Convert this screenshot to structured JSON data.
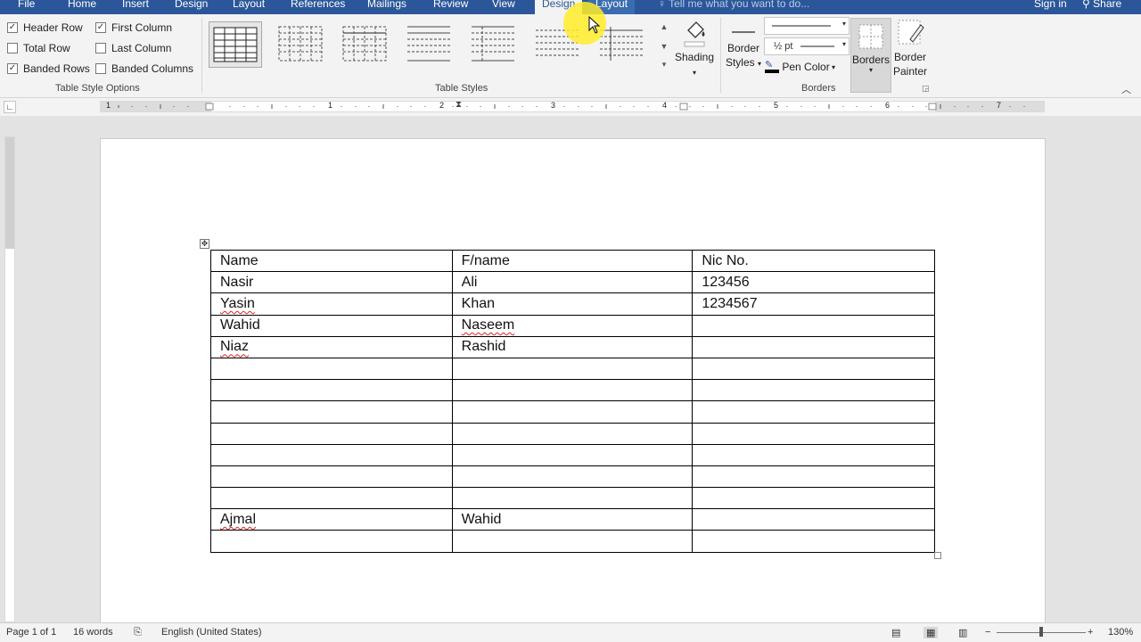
{
  "tabs": {
    "file": "File",
    "home": "Home",
    "insert": "Insert",
    "design": "Design",
    "layout": "Layout",
    "references": "References",
    "mailings": "Mailings",
    "review": "Review",
    "view": "View",
    "table_design": "Design",
    "table_layout": "Layout",
    "tell_me": "Tell me what you want to do...",
    "sign_in": "Sign in",
    "share": "Share"
  },
  "style_options": {
    "header_row": "Header Row",
    "total_row": "Total Row",
    "banded_rows": "Banded Rows",
    "first_column": "First Column",
    "last_column": "Last Column",
    "banded_columns": "Banded Columns",
    "header_row_checked": true,
    "total_row_checked": false,
    "banded_rows_checked": true,
    "first_column_checked": true,
    "last_column_checked": false,
    "banded_columns_checked": false,
    "group_label": "Table Style Options"
  },
  "table_styles": {
    "group_label": "Table Styles",
    "shading": "Shading"
  },
  "borders": {
    "border_styles_1": "Border",
    "border_styles_2": "Styles",
    "weight": "½ pt",
    "pen_color": "Pen Color",
    "borders_btn": "Borders",
    "border_painter_1": "Border",
    "border_painter_2": "Painter",
    "group_label": "Borders"
  },
  "ruler": {
    "n1": "1",
    "n1b": "1",
    "n2": "2",
    "n3": "3",
    "n4": "4",
    "n5": "5",
    "n6": "6",
    "n7": "7"
  },
  "document": {
    "rows": [
      [
        "Name",
        "F/name",
        "Nic No."
      ],
      [
        "Nasir",
        "Ali",
        "123456"
      ],
      [
        "Yasin",
        "Khan",
        "1234567"
      ],
      [
        "Wahid",
        "Naseem",
        ""
      ],
      [
        "Niaz",
        "Rashid",
        ""
      ],
      [
        "",
        "",
        ""
      ],
      [
        "",
        "",
        ""
      ],
      [
        "",
        "",
        ""
      ],
      [
        "",
        "",
        ""
      ],
      [
        "",
        "",
        ""
      ],
      [
        "",
        "",
        ""
      ],
      [
        "",
        "",
        ""
      ],
      [
        "Ajmal",
        "Wahid",
        ""
      ],
      [
        "",
        "",
        ""
      ]
    ]
  },
  "status": {
    "page": "Page 1 of 1",
    "words": "16 words",
    "language": "English (United States)",
    "zoom": "130%"
  },
  "colors": {
    "accent": "#2b579a",
    "highlight": "#ffec28"
  }
}
